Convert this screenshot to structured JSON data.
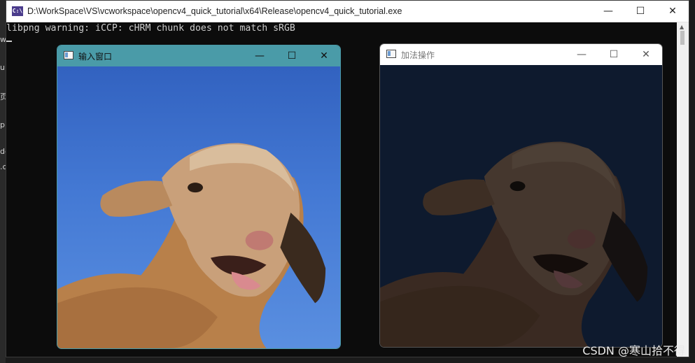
{
  "console": {
    "title": "D:\\WorkSpace\\VS\\vcworkspace\\opencv4_quick_tutorial\\x64\\Release\\opencv4_quick_tutorial.exe",
    "app_icon_text": "C:\\",
    "output_line": "libpng warning: iCCP: cHRM chunk does not match sRGB",
    "controls": {
      "minimize": "—",
      "maximize": "☐",
      "close": "✕"
    }
  },
  "windows": [
    {
      "title": "输入窗口",
      "state": "active",
      "titlebar_color": "#4a9ba8",
      "image": "lamb photo (original)"
    },
    {
      "title": "加法操作",
      "state": "inactive",
      "titlebar_color": "#ffffff",
      "image": "lamb photo (darkened)"
    }
  ],
  "background_glyphs": [
    "w",
    "ui",
    "页",
    "p",
    "de",
    ".c"
  ],
  "watermark": "CSDN @寒山拾不得",
  "colors": {
    "console_bg": "#0c0c0c",
    "console_text": "#cccccc",
    "accent_titlebar": "#4a9ba8"
  }
}
